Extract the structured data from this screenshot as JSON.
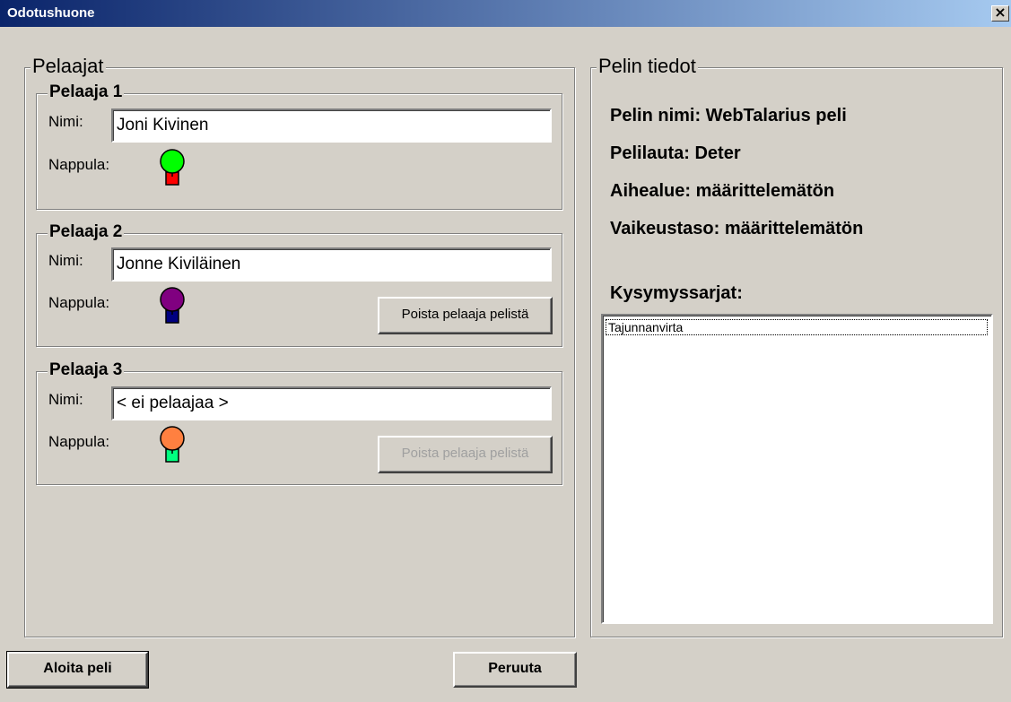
{
  "window": {
    "title": "Odotushuone",
    "close_glyph": "×"
  },
  "players_group": {
    "title": "Pelaajat"
  },
  "players": [
    {
      "heading": "Pelaaja 1",
      "name_label": "Nimi:",
      "name_value": "Joni Kivinen",
      "piece_label": "Nappula:",
      "piece_head_color": "#00ff00",
      "piece_body_color": "#ff0000",
      "remove_label": ""
    },
    {
      "heading": "Pelaaja 2",
      "name_label": "Nimi:",
      "name_value": "Jonne Kiviläinen",
      "piece_label": "Nappula:",
      "piece_head_color": "#800080",
      "piece_body_color": "#000080",
      "remove_label": "Poista pelaaja pelistä"
    },
    {
      "heading": "Pelaaja 3",
      "name_label": "Nimi:",
      "name_value": "< ei pelaajaa >",
      "piece_label": "Nappula:",
      "piece_head_color": "#ff8040",
      "piece_body_color": "#00ff80",
      "remove_label": "Poista pelaaja pelistä"
    }
  ],
  "game_info": {
    "title": "Pelin tiedot",
    "game_name": "Pelin nimi: WebTalarius peli",
    "board": "Pelilauta: Deter",
    "topic": "Aihealue: määrittelemätön",
    "difficulty": "Vaikeustaso: määrittelemätön",
    "question_sets_label": "Kysymyssarjat:",
    "question_sets": [
      "Tajunnanvirta"
    ]
  },
  "buttons": {
    "start": "Aloita peli",
    "cancel": "Peruuta"
  }
}
